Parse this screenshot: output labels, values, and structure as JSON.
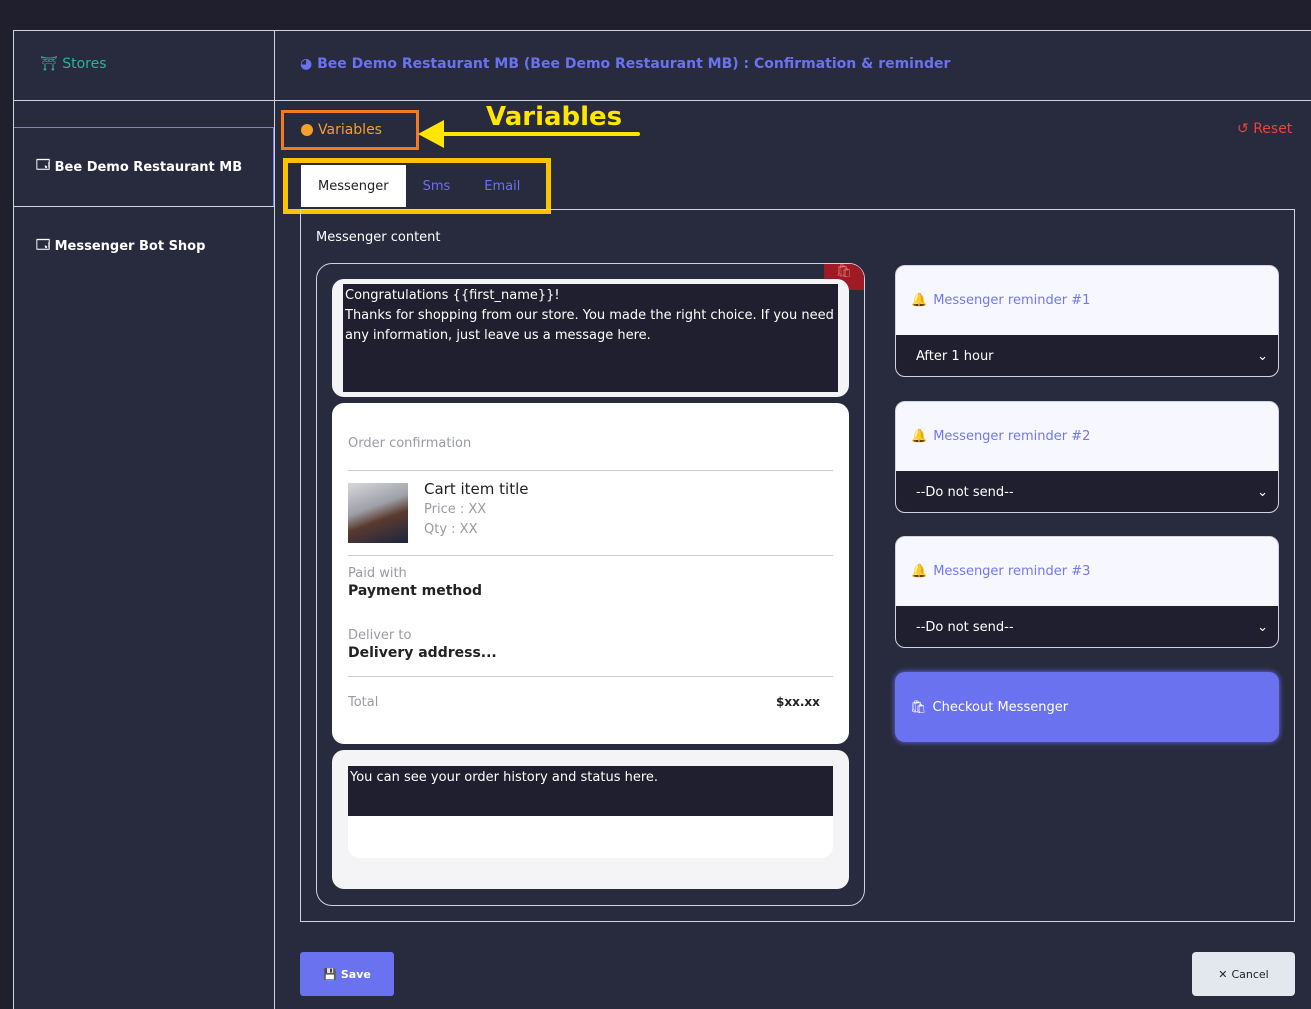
{
  "header": {
    "stores_label": "Stores",
    "title": "Bee Demo Restaurant MB (Bee Demo Restaurant MB) : Confirmation & reminder"
  },
  "sidebar": {
    "items": [
      {
        "label": "Bee Demo Restaurant MB"
      },
      {
        "label": "Messenger Bot Shop"
      }
    ]
  },
  "variables": {
    "label": "Variables",
    "annotation": "Variables"
  },
  "reset_label": "Reset",
  "tabs": [
    {
      "label": "Messenger"
    },
    {
      "label": "Sms"
    },
    {
      "label": "Email"
    }
  ],
  "content": {
    "label": "Messenger content",
    "message": "Congratulations {{first_name}}!\nThanks for shopping from our store. You made the right choice. If you need any information, just leave us a message here.",
    "order": {
      "heading": "Order confirmation",
      "item_title": "Cart item title",
      "price": "Price : XX",
      "qty": "Qty : XX",
      "paid_label": "Paid with",
      "paid_value": "Payment method",
      "deliver_label": "Deliver to",
      "deliver_value": "Delivery address...",
      "total_label": "Total",
      "total_value": "$xx.xx"
    },
    "footer_message": "You can see your order history and status here."
  },
  "reminders": [
    {
      "label": "Messenger reminder #1",
      "value": "After 1 hour"
    },
    {
      "label": "Messenger reminder #2",
      "value": "--Do not send--"
    },
    {
      "label": "Messenger reminder #3",
      "value": "--Do not send--"
    }
  ],
  "checkout_label": "Checkout Messenger",
  "save_label": "Save",
  "cancel_label": "Cancel",
  "colors": {
    "accent": "#6b72f0",
    "reset": "#f0413d",
    "variables": "#f4a029",
    "annotation": "#ffe600"
  }
}
